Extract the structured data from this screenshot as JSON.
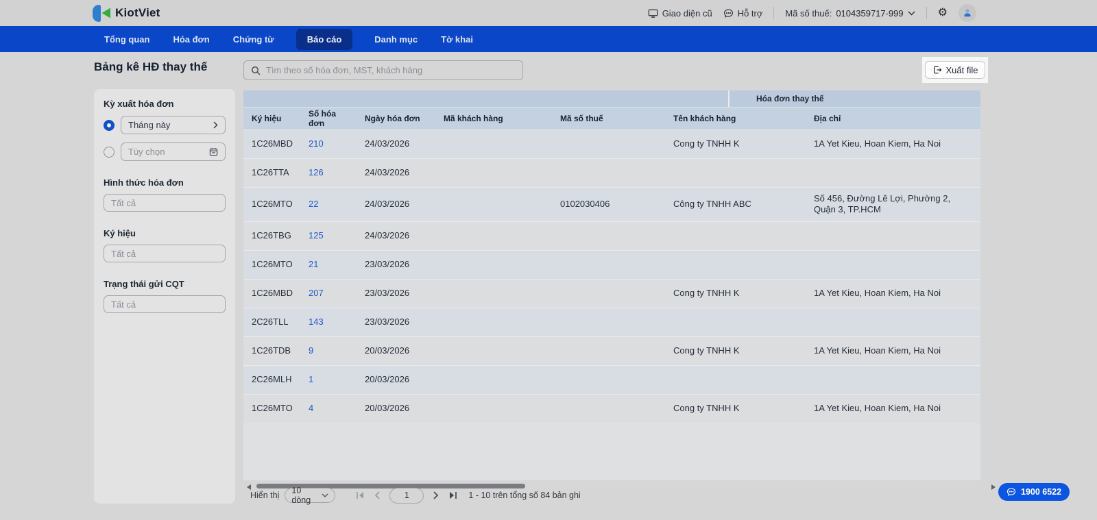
{
  "brand": {
    "name": "KiotViet",
    "logo_blue": "#2f7fd0",
    "logo_green": "#2fae3e"
  },
  "header": {
    "old_ui_label": "Giao diện cũ",
    "help_label": "Hỗ trợ",
    "tax_code_label": "Mã số thuế:",
    "tax_code_value": "0104359717-999"
  },
  "nav": {
    "items": [
      {
        "label": "Tổng quan",
        "active": false
      },
      {
        "label": "Hóa đơn",
        "active": false
      },
      {
        "label": "Chứng từ",
        "active": false
      },
      {
        "label": "Báo cáo",
        "active": true
      },
      {
        "label": "Danh mục",
        "active": false
      },
      {
        "label": "Tờ khai",
        "active": false
      }
    ]
  },
  "page": {
    "title": "Bảng kê HĐ thay thế"
  },
  "toolbar": {
    "search_placeholder": "Tìm theo số hóa đơn, MST, khách hàng",
    "export_label": "Xuất file"
  },
  "filters": {
    "period": {
      "label": "Kỳ xuất hóa đơn",
      "options": [
        {
          "label": "Tháng này",
          "selected": true
        },
        {
          "label": "Tùy chọn",
          "selected": false
        }
      ]
    },
    "invoice_form": {
      "label": "Hình thức hóa đơn",
      "value": "Tất cả"
    },
    "symbol": {
      "label": "Ký hiệu",
      "value": "Tất cả"
    },
    "cqt_status": {
      "label": "Trạng thái gửi CQT",
      "value": "Tất cả"
    }
  },
  "table": {
    "group_header": "Hóa đơn thay thế",
    "columns": [
      "Ký hiệu",
      "Số hóa đơn",
      "Ngày hóa đơn",
      "Mã khách hàng",
      "Mã số thuế",
      "Tên khách hàng",
      "Địa chỉ"
    ],
    "rows": [
      [
        "1C26MBD",
        "210",
        "24/03/2026",
        "",
        "",
        "Cong ty TNHH K",
        "1A Yet Kieu, Hoan Kiem, Ha Noi"
      ],
      [
        "1C26TTA",
        "126",
        "24/03/2026",
        "",
        "",
        "",
        ""
      ],
      [
        "1C26MTO",
        "22",
        "24/03/2026",
        "",
        "0102030406",
        "Công ty TNHH ABC",
        "Số 456, Đường Lê Lợi, Phường 2, Quận 3, TP.HCM"
      ],
      [
        "1C26TBG",
        "125",
        "24/03/2026",
        "",
        "",
        "",
        ""
      ],
      [
        "1C26MTO",
        "21",
        "23/03/2026",
        "",
        "",
        "",
        ""
      ],
      [
        "1C26MBD",
        "207",
        "23/03/2026",
        "",
        "",
        "Cong ty TNHH K",
        "1A Yet Kieu, Hoan Kiem, Ha Noi"
      ],
      [
        "2C26TLL",
        "143",
        "23/03/2026",
        "",
        "",
        "",
        ""
      ],
      [
        "1C26TDB",
        "9",
        "20/03/2026",
        "",
        "",
        "Cong ty TNHH K",
        "1A Yet Kieu, Hoan Kiem, Ha Noi"
      ],
      [
        "2C26MLH",
        "1",
        "20/03/2026",
        "",
        "",
        "",
        ""
      ],
      [
        "1C26MTO",
        "4",
        "20/03/2026",
        "",
        "",
        "Cong ty TNHH K",
        "1A Yet Kieu, Hoan Kiem, Ha Noi"
      ]
    ]
  },
  "pagination": {
    "show_label": "Hiển thị",
    "page_size": "10 dòng",
    "page_value": "1",
    "summary": "1 - 10 trên tổng số 84 bản ghi"
  },
  "support": {
    "phone": "1900 6522",
    "color": "#0b55e2"
  }
}
